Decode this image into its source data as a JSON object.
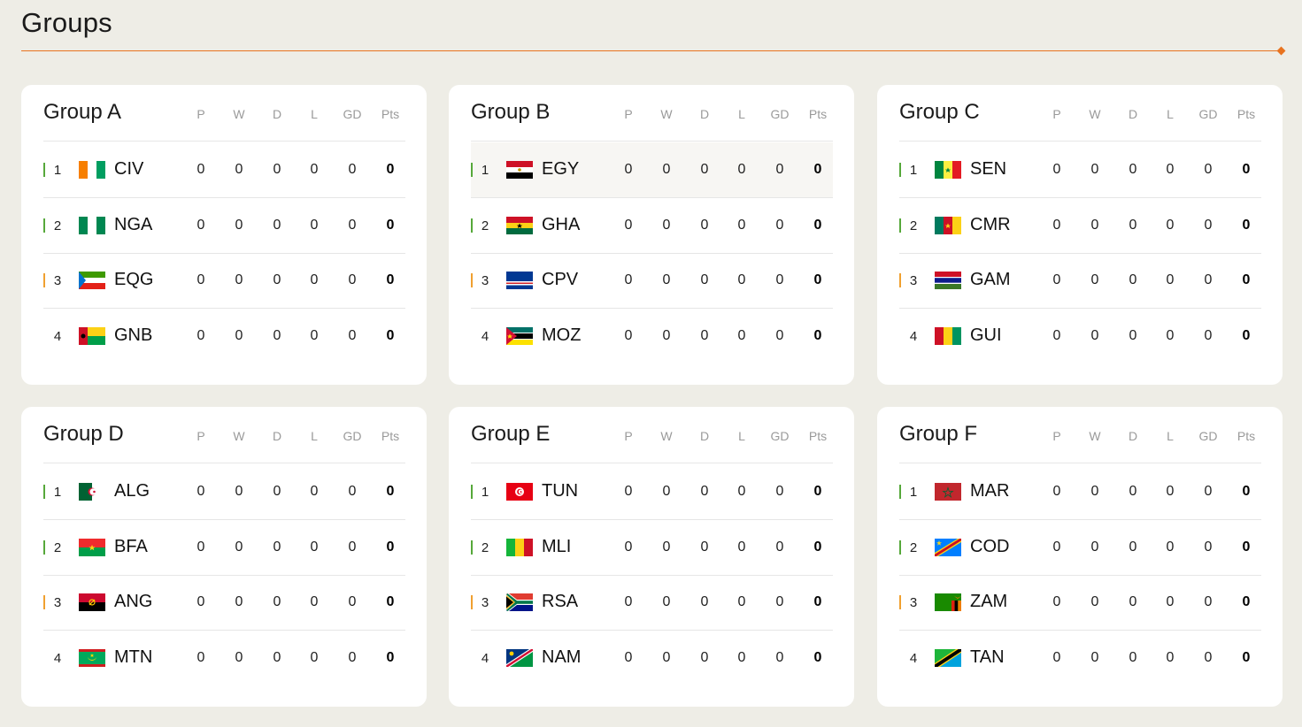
{
  "page": {
    "title": "Groups"
  },
  "columns": [
    "P",
    "W",
    "D",
    "L",
    "GD",
    "Pts"
  ],
  "colors": {
    "accent": "#e8731f",
    "qualify": "#56a83a",
    "third": "#f0a030"
  },
  "groups": [
    {
      "name": "Group A",
      "rows": [
        {
          "pos": "1",
          "code": "CIV",
          "flag": "flag-civ-icon",
          "p": "0",
          "w": "0",
          "d": "0",
          "l": "0",
          "gd": "0",
          "pts": "0"
        },
        {
          "pos": "2",
          "code": "NGA",
          "flag": "flag-nga-icon",
          "p": "0",
          "w": "0",
          "d": "0",
          "l": "0",
          "gd": "0",
          "pts": "0"
        },
        {
          "pos": "3",
          "code": "EQG",
          "flag": "flag-eqg-icon",
          "p": "0",
          "w": "0",
          "d": "0",
          "l": "0",
          "gd": "0",
          "pts": "0"
        },
        {
          "pos": "4",
          "code": "GNB",
          "flag": "flag-gnb-icon",
          "p": "0",
          "w": "0",
          "d": "0",
          "l": "0",
          "gd": "0",
          "pts": "0"
        }
      ]
    },
    {
      "name": "Group B",
      "rows": [
        {
          "pos": "1",
          "code": "EGY",
          "flag": "flag-egy-icon",
          "p": "0",
          "w": "0",
          "d": "0",
          "l": "0",
          "gd": "0",
          "pts": "0"
        },
        {
          "pos": "2",
          "code": "GHA",
          "flag": "flag-gha-icon",
          "p": "0",
          "w": "0",
          "d": "0",
          "l": "0",
          "gd": "0",
          "pts": "0"
        },
        {
          "pos": "3",
          "code": "CPV",
          "flag": "flag-cpv-icon",
          "p": "0",
          "w": "0",
          "d": "0",
          "l": "0",
          "gd": "0",
          "pts": "0"
        },
        {
          "pos": "4",
          "code": "MOZ",
          "flag": "flag-moz-icon",
          "p": "0",
          "w": "0",
          "d": "0",
          "l": "0",
          "gd": "0",
          "pts": "0"
        }
      ]
    },
    {
      "name": "Group C",
      "rows": [
        {
          "pos": "1",
          "code": "SEN",
          "flag": "flag-sen-icon",
          "p": "0",
          "w": "0",
          "d": "0",
          "l": "0",
          "gd": "0",
          "pts": "0"
        },
        {
          "pos": "2",
          "code": "CMR",
          "flag": "flag-cmr-icon",
          "p": "0",
          "w": "0",
          "d": "0",
          "l": "0",
          "gd": "0",
          "pts": "0"
        },
        {
          "pos": "3",
          "code": "GAM",
          "flag": "flag-gam-icon",
          "p": "0",
          "w": "0",
          "d": "0",
          "l": "0",
          "gd": "0",
          "pts": "0"
        },
        {
          "pos": "4",
          "code": "GUI",
          "flag": "flag-gui-icon",
          "p": "0",
          "w": "0",
          "d": "0",
          "l": "0",
          "gd": "0",
          "pts": "0"
        }
      ]
    },
    {
      "name": "Group D",
      "rows": [
        {
          "pos": "1",
          "code": "ALG",
          "flag": "flag-alg-icon",
          "p": "0",
          "w": "0",
          "d": "0",
          "l": "0",
          "gd": "0",
          "pts": "0"
        },
        {
          "pos": "2",
          "code": "BFA",
          "flag": "flag-bfa-icon",
          "p": "0",
          "w": "0",
          "d": "0",
          "l": "0",
          "gd": "0",
          "pts": "0"
        },
        {
          "pos": "3",
          "code": "ANG",
          "flag": "flag-ang-icon",
          "p": "0",
          "w": "0",
          "d": "0",
          "l": "0",
          "gd": "0",
          "pts": "0"
        },
        {
          "pos": "4",
          "code": "MTN",
          "flag": "flag-mtn-icon",
          "p": "0",
          "w": "0",
          "d": "0",
          "l": "0",
          "gd": "0",
          "pts": "0"
        }
      ]
    },
    {
      "name": "Group E",
      "rows": [
        {
          "pos": "1",
          "code": "TUN",
          "flag": "flag-tun-icon",
          "p": "0",
          "w": "0",
          "d": "0",
          "l": "0",
          "gd": "0",
          "pts": "0"
        },
        {
          "pos": "2",
          "code": "MLI",
          "flag": "flag-mli-icon",
          "p": "0",
          "w": "0",
          "d": "0",
          "l": "0",
          "gd": "0",
          "pts": "0"
        },
        {
          "pos": "3",
          "code": "RSA",
          "flag": "flag-rsa-icon",
          "p": "0",
          "w": "0",
          "d": "0",
          "l": "0",
          "gd": "0",
          "pts": "0"
        },
        {
          "pos": "4",
          "code": "NAM",
          "flag": "flag-nam-icon",
          "p": "0",
          "w": "0",
          "d": "0",
          "l": "0",
          "gd": "0",
          "pts": "0"
        }
      ]
    },
    {
      "name": "Group F",
      "rows": [
        {
          "pos": "1",
          "code": "MAR",
          "flag": "flag-mar-icon",
          "p": "0",
          "w": "0",
          "d": "0",
          "l": "0",
          "gd": "0",
          "pts": "0"
        },
        {
          "pos": "2",
          "code": "COD",
          "flag": "flag-cod-icon",
          "p": "0",
          "w": "0",
          "d": "0",
          "l": "0",
          "gd": "0",
          "pts": "0"
        },
        {
          "pos": "3",
          "code": "ZAM",
          "flag": "flag-zam-icon",
          "p": "0",
          "w": "0",
          "d": "0",
          "l": "0",
          "gd": "0",
          "pts": "0"
        },
        {
          "pos": "4",
          "code": "TAN",
          "flag": "flag-tan-icon",
          "p": "0",
          "w": "0",
          "d": "0",
          "l": "0",
          "gd": "0",
          "pts": "0"
        }
      ]
    }
  ]
}
